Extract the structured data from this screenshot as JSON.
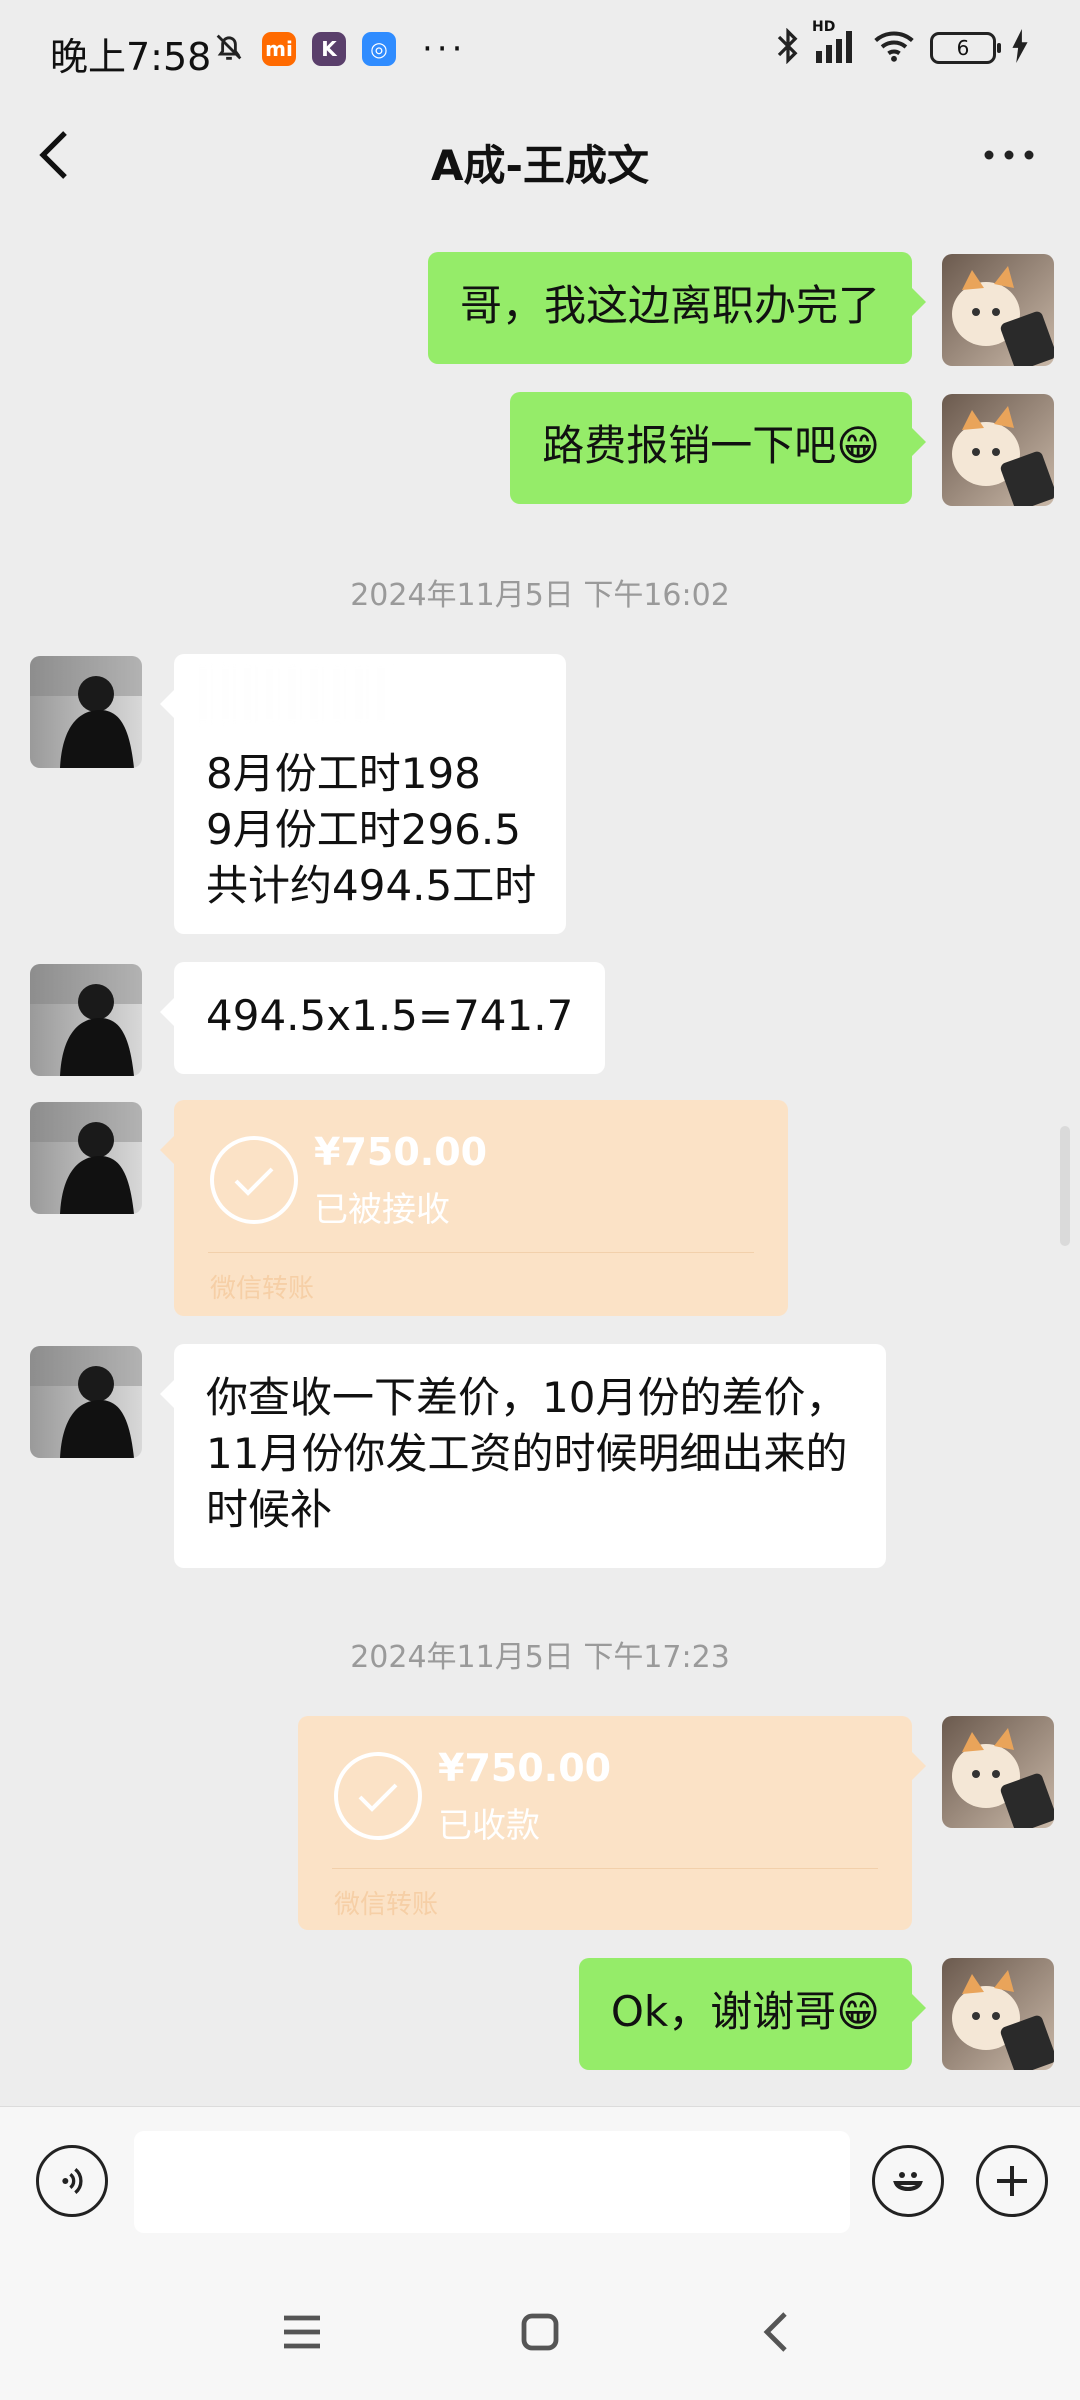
{
  "status_bar": {
    "time": "晚上7:58",
    "battery": "6",
    "signal_label": "HD",
    "left_icons": [
      "bell-muted-icon",
      "mi-app-icon",
      "k-app-icon",
      "app-icon",
      "more-dots"
    ],
    "right_icons": [
      "bluetooth-icon",
      "signal-icon",
      "wifi-icon",
      "battery-icon",
      "charging-icon"
    ]
  },
  "header": {
    "title": "A成-王成文"
  },
  "messages": [
    {
      "sender": "me",
      "type": "text",
      "text": "哥，我这边离职办完了"
    },
    {
      "sender": "me",
      "type": "text",
      "text": "路费报销一下吧😁"
    },
    {
      "type": "timestamp",
      "text": "2024年11月5日 下午16:02"
    },
    {
      "sender": "other",
      "type": "text",
      "lines": [
        "",
        "8月份工时198",
        "9月份工时296.5",
        "共计约494.5工时"
      ]
    },
    {
      "sender": "other",
      "type": "text",
      "text": "494.5x1.5=741.7"
    },
    {
      "sender": "other",
      "type": "transfer",
      "amount": "¥750.00",
      "status": "已被接收",
      "footer": "微信转账"
    },
    {
      "sender": "other",
      "type": "text",
      "lines": [
        "你查收一下差价，10月份的差价，",
        "11月份你发工资的时候明细出来的",
        "时候补"
      ]
    },
    {
      "type": "timestamp",
      "text": "2024年11月5日 下午17:23"
    },
    {
      "sender": "me",
      "type": "transfer",
      "amount": "¥750.00",
      "status": "已收款",
      "footer": "微信转账"
    },
    {
      "sender": "me",
      "type": "text",
      "text": "Ok，谢谢哥😁"
    }
  ],
  "input": {
    "placeholder": "",
    "value": ""
  },
  "colors": {
    "my_bubble": "#95ec69",
    "their_bubble": "#ffffff",
    "transfer": "#fbe2c6",
    "background": "#ededed"
  }
}
